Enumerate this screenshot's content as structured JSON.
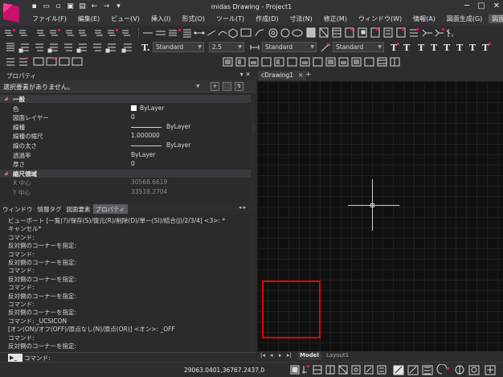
{
  "window": {
    "title": "midas Drawing - Project1",
    "controls": [
      "─",
      "□",
      "✕"
    ]
  },
  "menu": [
    "ファイル(F)",
    "編集(E)",
    "ビュー(V)",
    "挿入(I)",
    "形式(O)",
    "ツール(T)",
    "作成(D)",
    "寸法(N)",
    "修正(M)",
    "ウィンドウ(W)",
    "情報(A)",
    "図面生成(G)",
    "図面"
  ],
  "toolbar": {
    "text_style": "Standard",
    "text_height": "2.5",
    "dim_style": "Standard",
    "leader_style": "Standard"
  },
  "properties": {
    "title": "プロパティ",
    "pins": "▾ ✕",
    "selection": "選択要素がありません。",
    "buttons": [
      "+",
      "⬚",
      "↯"
    ],
    "rows": [
      {
        "type": "cat",
        "key": "一般",
        "tri": "◢"
      },
      {
        "type": "row",
        "key": "色",
        "value": "ByLayer",
        "swatch": "chip"
      },
      {
        "type": "row",
        "key": "図面レイヤー",
        "value": "0"
      },
      {
        "type": "row",
        "key": "線種",
        "value": "ByLayer",
        "swatch": "line"
      },
      {
        "type": "row",
        "key": "線種の縮尺",
        "value": "1.000000"
      },
      {
        "type": "row",
        "key": "線の太さ",
        "value": "ByLayer",
        "swatch": "line"
      },
      {
        "type": "row",
        "key": "透過率",
        "value": "ByLayer"
      },
      {
        "type": "row",
        "key": "厚さ",
        "value": "0"
      },
      {
        "type": "cat",
        "key": "縮尺領域",
        "tri": "◢"
      },
      {
        "type": "dim",
        "key": "X 中心",
        "value": "30568.6619"
      },
      {
        "type": "dim",
        "key": "Y 中心",
        "value": "33518.2704"
      }
    ],
    "tabs": [
      {
        "label": "ウィンドウ",
        "active": false
      },
      {
        "label": "情報タグ",
        "active": false
      },
      {
        "label": "図面要素",
        "active": false
      },
      {
        "label": "プロパティ",
        "active": true
      }
    ],
    "tab_nav": "◂ ▸"
  },
  "command": {
    "lines": [
      "ビューポート [一覧(?)/保存(S)/復元(R)/削除(D)/単一(SI)/結合(J)/2/3/4] <3>: *",
      "キャンセル*",
      "コマンド:",
      "反対側のコーナーを指定:",
      "コマンド:",
      "反対側のコーナーを指定:",
      "コマンド:",
      "反対側のコーナーを指定:",
      "コマンド:",
      "反対側のコーナーを指定:",
      "コマンド:",
      "反対側のコーナーを指定:",
      "コマンド: _UCSICON",
      "[オン(ON)/オフ(OFF)/原点なし(N)/原点(OR)] <オン>: _OFF",
      "コマンド:",
      "反対側のコーナーを指定:"
    ],
    "prompt_icon": "▶_",
    "prompt": "コマンド:"
  },
  "drawing": {
    "tab": "cDrawing1",
    "tab_close": "✕",
    "tab_add": "+",
    "layout_nav": [
      "|◂",
      "◂",
      "▸",
      "▸|"
    ],
    "model_tab": "Model",
    "layout_tab": "Layout1"
  },
  "status": {
    "coords": "29063.0401,36767.2437,0"
  },
  "colors": {
    "accent_magenta": "#e0157a",
    "selection_box": "#e60000"
  }
}
